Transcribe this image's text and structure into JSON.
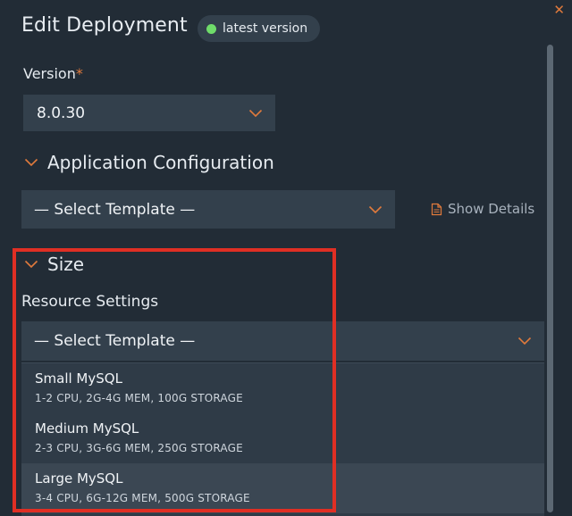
{
  "header": {
    "title": "Edit Deployment",
    "badge_label": "latest version",
    "badge_dot_color": "#6fdc6a",
    "close_icon": "close-icon"
  },
  "version": {
    "label": "Version",
    "required_mark": "*",
    "selected": "8.0.30"
  },
  "app_config": {
    "heading": "Application Configuration",
    "template_selected": "— Select Template —",
    "show_details_label": "Show Details"
  },
  "size": {
    "heading": "Size",
    "resource_label": "Resource Settings",
    "template_selected": "— Select Template —",
    "options": [
      {
        "name": "Small MySQL",
        "desc": "1-2 CPU, 2G-4G MEM, 100G STORAGE"
      },
      {
        "name": "Medium MySQL",
        "desc": "2-3 CPU, 3G-6G MEM, 250G STORAGE"
      },
      {
        "name": "Large MySQL",
        "desc": "3-4 CPU, 6G-12G MEM, 500G STORAGE"
      }
    ]
  },
  "colors": {
    "background": "#222c36",
    "input_bg": "#33404c",
    "accent": "#e07a3c",
    "highlight": "#e02f24"
  }
}
